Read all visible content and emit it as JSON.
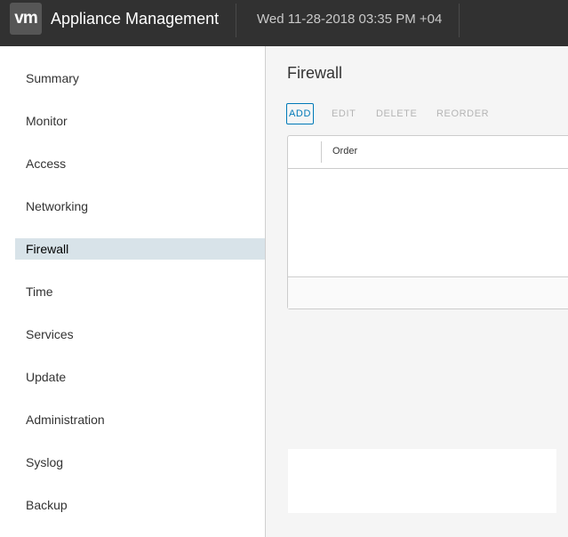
{
  "header": {
    "logo_text": "vm",
    "app_title": "Appliance Management",
    "datetime": "Wed 11-28-2018 03:35 PM +04"
  },
  "sidebar": {
    "items": [
      {
        "label": "Summary"
      },
      {
        "label": "Monitor"
      },
      {
        "label": "Access"
      },
      {
        "label": "Networking"
      },
      {
        "label": "Firewall",
        "active": true
      },
      {
        "label": "Time"
      },
      {
        "label": "Services"
      },
      {
        "label": "Update"
      },
      {
        "label": "Administration"
      },
      {
        "label": "Syslog"
      },
      {
        "label": "Backup"
      }
    ]
  },
  "main": {
    "title": "Firewall",
    "toolbar": {
      "add": "ADD",
      "edit": "EDIT",
      "delete": "DELETE",
      "reorder": "REORDER"
    },
    "grid": {
      "columns": [
        "Order"
      ]
    }
  },
  "colors": {
    "header_bg": "#313131",
    "accent": "#0079b8",
    "active_nav_bg": "#d8e3e9"
  }
}
